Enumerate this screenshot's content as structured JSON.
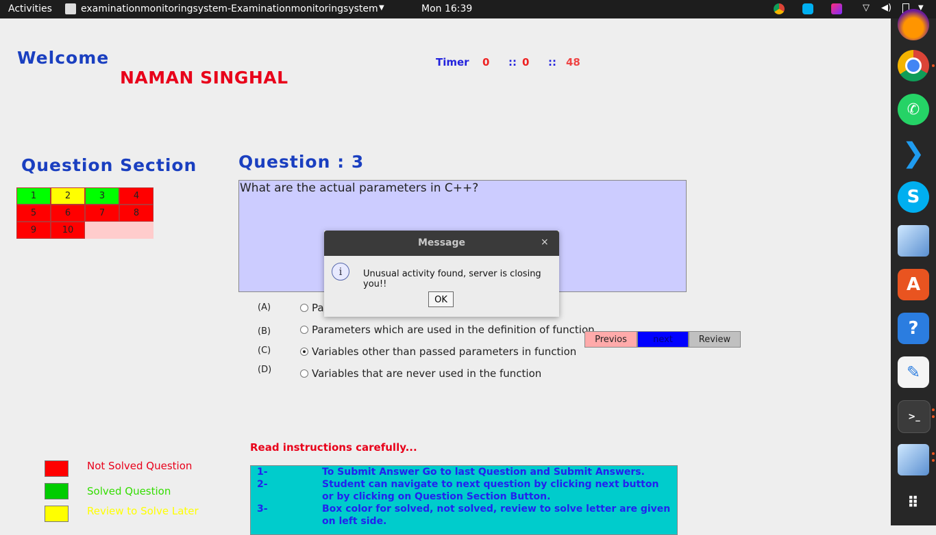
{
  "topbar": {
    "activities": "Activities",
    "app_title": "examinationmonitoringsystem-Examinationmonitoringsystem",
    "clock": "Mon 16:39"
  },
  "dock": {
    "items": [
      "firefox",
      "chrome",
      "whatsapp",
      "vscode",
      "skype",
      "virtualbox",
      "software-center",
      "help",
      "text-editor",
      "terminal",
      "virtualbox-2",
      "app-grid"
    ],
    "help_label": "?"
  },
  "header": {
    "welcome": "Welcome",
    "username": "NAMAN SINGHAL"
  },
  "timer": {
    "label": "Timer",
    "hours": "0",
    "minutes": "0",
    "seconds": "48",
    "separator": "::"
  },
  "question_section": {
    "title": "Question Section",
    "cells": [
      {
        "label": "1",
        "color": "#00ff00"
      },
      {
        "label": "2",
        "color": "#ffff00"
      },
      {
        "label": "3",
        "color": "#00ff00"
      },
      {
        "label": "4",
        "color": "#ff0000"
      },
      {
        "label": "5",
        "color": "#ff0000"
      },
      {
        "label": "6",
        "color": "#ff0000"
      },
      {
        "label": "7",
        "color": "#ff0000"
      },
      {
        "label": "8",
        "color": "#ff0000"
      },
      {
        "label": "9",
        "color": "#ff0000"
      },
      {
        "label": "10",
        "color": "#ff0000"
      }
    ]
  },
  "question": {
    "title": "Question :",
    "number": "3",
    "text": "What are the actual parameters in C++?"
  },
  "options": [
    {
      "letter": "(A)",
      "text": "Pa",
      "checked": false
    },
    {
      "letter": "(B)",
      "text": "Parameters which are used in the definition of function",
      "checked": false
    },
    {
      "letter": "(C)",
      "text": "Variables other than passed parameters in function",
      "checked": true
    },
    {
      "letter": "(D)",
      "text": "Variables that are never used in the function",
      "checked": false
    }
  ],
  "nav_buttons": {
    "previous": "Previos",
    "next": "next",
    "review": "Review"
  },
  "instructions": {
    "heading": "Read instructions carefully...",
    "items": [
      {
        "num": "1-",
        "lines": [
          "To Submit Answer Go to last Question and Submit Answers."
        ]
      },
      {
        "num": "2-",
        "lines": [
          "Student can navigate to next question by clicking next button",
          "or by clicking on Question Section Button."
        ]
      },
      {
        "num": "3-",
        "lines": [
          "Box color for solved, not solved, review to solve letter are given",
          "on left side."
        ]
      }
    ]
  },
  "legend": [
    {
      "label": "Not Solved Question",
      "color": "#ff0000",
      "text_color": "#e8001a"
    },
    {
      "label": "Solved Question",
      "color": "#00cc00",
      "text_color": "#33dd00"
    },
    {
      "label": "Review to Solve Later",
      "color": "#ffff00",
      "text_color": "#ffff00"
    }
  ],
  "dialog": {
    "title": "Message",
    "message": "Unusual activity found, server is closing you!!",
    "ok": "OK",
    "close_glyph": "×",
    "info_glyph": "i"
  }
}
